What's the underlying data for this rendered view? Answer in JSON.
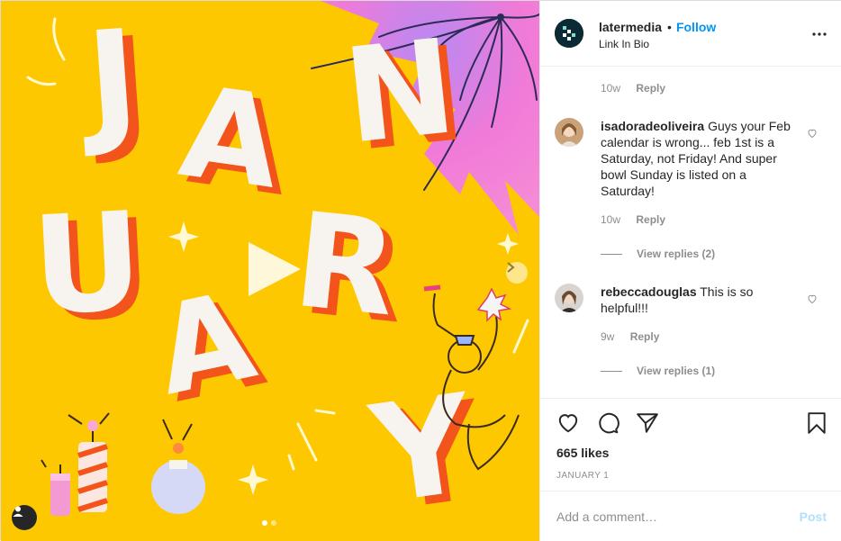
{
  "header": {
    "username": "latermedia",
    "separator": "•",
    "follow_label": "Follow",
    "location": "Link In Bio"
  },
  "comments": {
    "first_meta": {
      "age": "10w",
      "reply_label": "Reply"
    },
    "items": [
      {
        "username": "isadoradeoliveira",
        "text": "Guys your Feb calendar is wrong... feb 1st is a Saturday, not Friday! And super bowl Sunday is listed on a Saturday!",
        "age": "10w",
        "reply_label": "Reply",
        "view_replies": "View replies (2)"
      },
      {
        "username": "rebeccadouglas",
        "text": "This is so helpful!!!",
        "age": "9w",
        "reply_label": "Reply",
        "view_replies": "View replies (1)"
      }
    ]
  },
  "actions": {
    "likes": "665 likes",
    "date": "JANUARY 1"
  },
  "add_comment": {
    "placeholder": "Add a comment…",
    "post_label": "Post"
  },
  "media": {
    "letters": [
      "J",
      "A",
      "N",
      "U",
      "A",
      "R",
      "Y",
      "A"
    ],
    "carousel": {
      "slides": 2,
      "current": 1
    }
  },
  "colors": {
    "background_yellow": "#fdc800",
    "burst_pink": "#f07ad8",
    "letter_shadow": "#f2541b",
    "link_blue": "#0095f6"
  }
}
